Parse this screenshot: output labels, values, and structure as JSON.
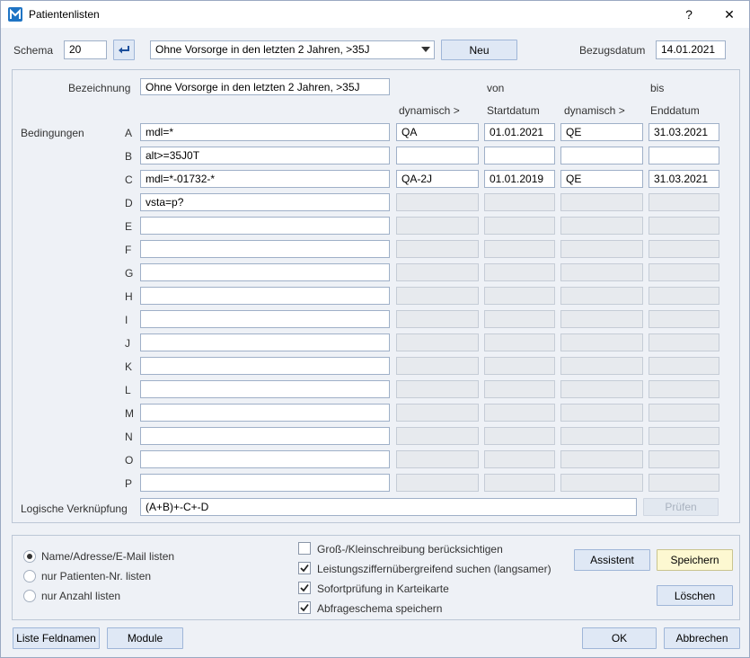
{
  "window": {
    "title": "Patientenlisten",
    "help": "?",
    "close": "✕"
  },
  "header": {
    "schema_label": "Schema",
    "schema_value": "20",
    "schema_select": "Ohne Vorsorge in den letzten 2 Jahren, >35J",
    "new_label": "Neu",
    "bezugsdatum_label": "Bezugsdatum",
    "bezugsdatum_value": "14.01.2021"
  },
  "form": {
    "bezeichnung_label": "Bezeichnung",
    "bezeichnung_value": "Ohne Vorsorge in den letzten 2 Jahren, >35J",
    "von_label": "von",
    "bis_label": "bis",
    "col_dynamisch1": "dynamisch >",
    "col_startdatum": "Startdatum",
    "col_dynamisch2": "dynamisch >",
    "col_enddatum": "Enddatum",
    "bedingungen_label": "Bedingungen",
    "rows": [
      {
        "letter": "A",
        "cond": "mdl=*",
        "dyn1": "QA",
        "start": "01.01.2021",
        "dyn2": "QE",
        "end": "31.03.2021",
        "enabled": true
      },
      {
        "letter": "B",
        "cond": "alt>=35J0T",
        "dyn1": "",
        "start": "",
        "dyn2": "",
        "end": "",
        "enabled": true
      },
      {
        "letter": "C",
        "cond": "mdl=*-01732-*",
        "dyn1": "QA-2J",
        "start": "01.01.2019",
        "dyn2": "QE",
        "end": "31.03.2021",
        "enabled": true
      },
      {
        "letter": "D",
        "cond": "vsta=p?",
        "dyn1": "",
        "start": "",
        "dyn2": "",
        "end": "",
        "enabled": false
      },
      {
        "letter": "E",
        "cond": "",
        "dyn1": "",
        "start": "",
        "dyn2": "",
        "end": "",
        "enabled": false
      },
      {
        "letter": "F",
        "cond": "",
        "dyn1": "",
        "start": "",
        "dyn2": "",
        "end": "",
        "enabled": false
      },
      {
        "letter": "G",
        "cond": "",
        "dyn1": "",
        "start": "",
        "dyn2": "",
        "end": "",
        "enabled": false
      },
      {
        "letter": "H",
        "cond": "",
        "dyn1": "",
        "start": "",
        "dyn2": "",
        "end": "",
        "enabled": false
      },
      {
        "letter": "I",
        "cond": "",
        "dyn1": "",
        "start": "",
        "dyn2": "",
        "end": "",
        "enabled": false
      },
      {
        "letter": "J",
        "cond": "",
        "dyn1": "",
        "start": "",
        "dyn2": "",
        "end": "",
        "enabled": false
      },
      {
        "letter": "K",
        "cond": "",
        "dyn1": "",
        "start": "",
        "dyn2": "",
        "end": "",
        "enabled": false
      },
      {
        "letter": "L",
        "cond": "",
        "dyn1": "",
        "start": "",
        "dyn2": "",
        "end": "",
        "enabled": false
      },
      {
        "letter": "M",
        "cond": "",
        "dyn1": "",
        "start": "",
        "dyn2": "",
        "end": "",
        "enabled": false
      },
      {
        "letter": "N",
        "cond": "",
        "dyn1": "",
        "start": "",
        "dyn2": "",
        "end": "",
        "enabled": false
      },
      {
        "letter": "O",
        "cond": "",
        "dyn1": "",
        "start": "",
        "dyn2": "",
        "end": "",
        "enabled": false
      },
      {
        "letter": "P",
        "cond": "",
        "dyn1": "",
        "start": "",
        "dyn2": "",
        "end": "",
        "enabled": false
      }
    ],
    "logic_label": "Logische Verknüpfung",
    "logic_value": "(A+B)+-C+-D",
    "pruefen_label": "Prüfen"
  },
  "options": {
    "radios": [
      {
        "label": "Name/Adresse/E-Mail listen",
        "checked": true
      },
      {
        "label": "nur Patienten-Nr. listen",
        "checked": false
      },
      {
        "label": "nur Anzahl listen",
        "checked": false
      }
    ],
    "checks": [
      {
        "label": "Groß-/Kleinschreibung berücksichtigen",
        "checked": false
      },
      {
        "label": "Leistungsziffernübergreifend suchen (langsamer)",
        "checked": true
      },
      {
        "label": "Sofortprüfung in Karteikarte",
        "checked": true
      },
      {
        "label": "Abfrageschema speichern",
        "checked": true
      }
    ],
    "assistent_label": "Assistent",
    "speichern_label": "Speichern",
    "loeschen_label": "Löschen"
  },
  "footer": {
    "feldnamen_label": "Liste Feldnamen",
    "module_label": "Module",
    "ok_label": "OK",
    "abbrechen_label": "Abbrechen"
  }
}
